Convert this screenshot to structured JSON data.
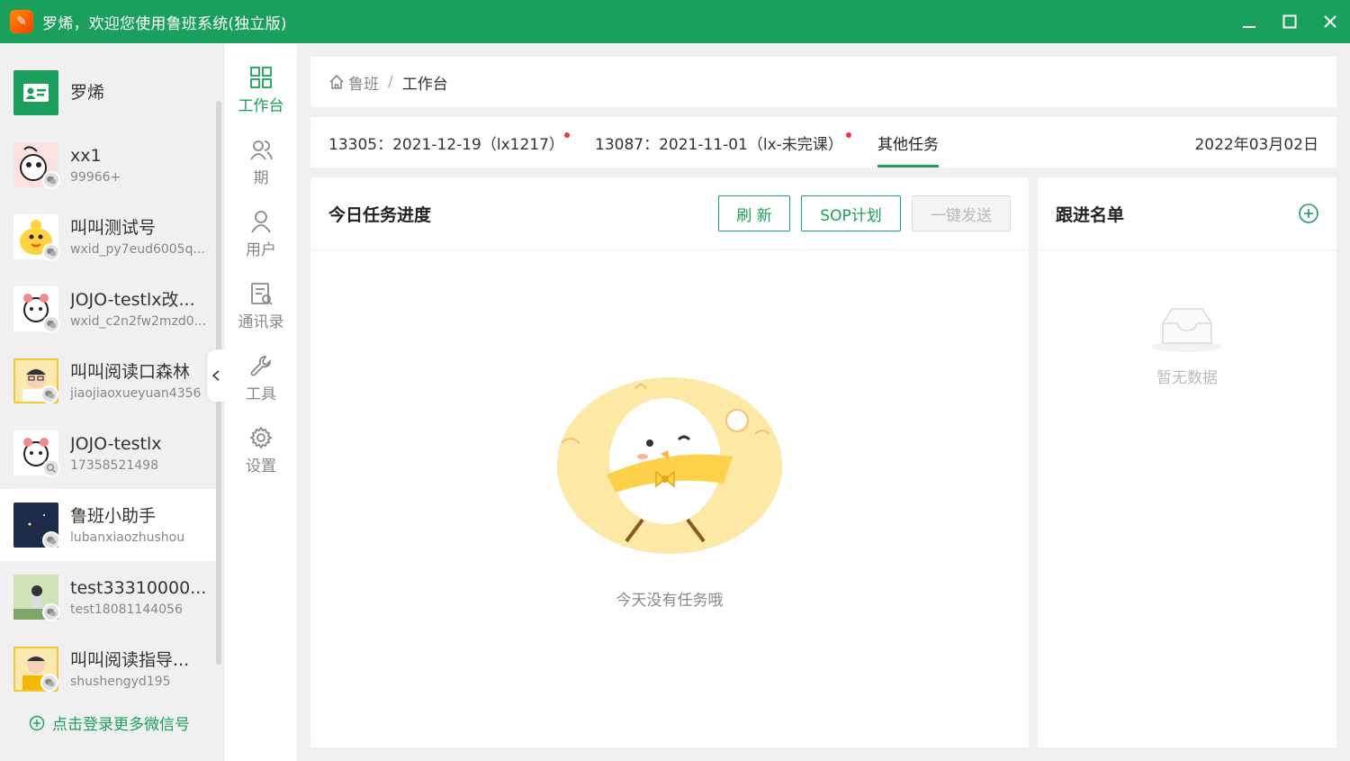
{
  "window": {
    "title": "罗烯，欢迎您使用鲁班系统(独立版)",
    "logo_icon": "luban-logo-icon",
    "controls": [
      "minimize",
      "maximize",
      "close"
    ]
  },
  "colors": {
    "brand": "#1aa05c",
    "notice_dot": "#f5333f"
  },
  "accounts": [
    {
      "name": "罗烯",
      "sub": "",
      "avatar": "contact-card-icon"
    },
    {
      "name": "xx1",
      "sub": "99966+",
      "avatar": "cartoon-avatar"
    },
    {
      "name": "叫叫测试号",
      "sub": "wxid_py7eud6005q...",
      "avatar": "duck-avatar"
    },
    {
      "name": "JOJO-testlx改...",
      "sub": "wxid_c2n2fw2mzd0...",
      "avatar": "cartoon-avatar"
    },
    {
      "name": "叫叫阅读口森林",
      "sub": "jiaojiaoxueyuan4356",
      "avatar": "person-avatar"
    },
    {
      "name": "JOJO-testlx",
      "sub": "17358521498",
      "avatar": "cartoon-avatar"
    },
    {
      "name": "鲁班小助手",
      "sub": "lubanxiaozhushou",
      "avatar": "night-avatar"
    },
    {
      "name": "test33310000...",
      "sub": "test18081144056",
      "avatar": "photo-avatar"
    },
    {
      "name": "叫叫阅读指导...",
      "sub": "shushengyd195",
      "avatar": "person-avatar"
    }
  ],
  "login_more": "点击登录更多微信号",
  "nav": [
    {
      "label": "工作台",
      "icon": "grid-icon",
      "active": true
    },
    {
      "label": "期",
      "icon": "group-icon",
      "active": false
    },
    {
      "label": "用户",
      "icon": "user-icon",
      "active": false
    },
    {
      "label": "通讯录",
      "icon": "contacts-icon",
      "active": false
    },
    {
      "label": "工具",
      "icon": "wrench-icon",
      "active": false
    },
    {
      "label": "设置",
      "icon": "gear-icon",
      "active": false
    }
  ],
  "breadcrumb": {
    "home": "鲁班",
    "separator": "/",
    "current": "工作台"
  },
  "tabs": [
    {
      "label": "13305：2021-12-19（lx1217）",
      "dot": true
    },
    {
      "label": "13087：2021-11-01（lx-未完课）",
      "dot": true
    },
    {
      "label": "其他任务",
      "active": true
    }
  ],
  "date": "2022年03月02日",
  "task_panel": {
    "title": "今日任务进度",
    "refresh": "刷 新",
    "sop": "SOP计划",
    "send": "一键发送",
    "empty": "今天没有任务哦"
  },
  "follow_panel": {
    "title": "跟进名单",
    "empty": "暂无数据"
  }
}
